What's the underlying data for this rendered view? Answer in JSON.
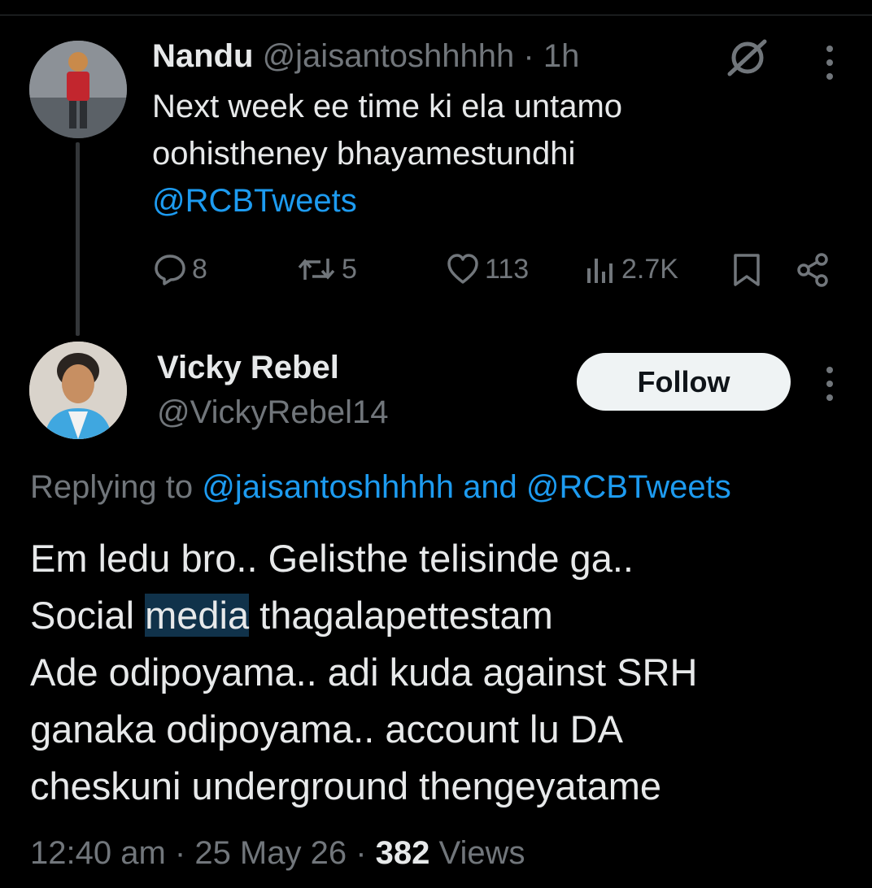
{
  "parent_tweet": {
    "display_name": "Nandu",
    "handle": "@jaisantoshhhhh",
    "separator": "·",
    "time": "1h",
    "text_line1": "Next week ee time ki ela untamo",
    "text_line2": "oohistheney bhayamestundhi",
    "mention": "@RCBTweets",
    "stats": {
      "replies": "8",
      "reposts": "5",
      "likes": "113",
      "views": "2.7K"
    },
    "grok_icon": "grok-icon",
    "more_icon": "more-icon"
  },
  "reply_tweet": {
    "display_name": "Vicky Rebel",
    "handle": "@VickyRebel14",
    "follow_label": "Follow",
    "replying_to_prefix": "Replying to ",
    "replying_to_user": "@jaisantoshhhhh",
    "replying_to_and": " and ",
    "replying_to_user2": "@RCBTweets",
    "line1": "Em ledu bro.. Gelisthe telisinde ga..",
    "line2_prefix": "Social ",
    "line2_highlight": "media",
    "line2_suffix": " thagalapettestam",
    "line3": "Ade odipoyama.. adi kuda against SRH",
    "line4": "ganaka odipoyama.. account lu DA",
    "line5": "cheskuni underground thengeyatame",
    "timestamp": "12:40 am · 25 May 26 · ",
    "views_count": "382",
    "views_label": " Views"
  },
  "colors": {
    "background": "#000000",
    "text": "#e7e9ea",
    "muted": "#71767b",
    "link": "#1d9bf0",
    "highlight": "#10324a"
  }
}
